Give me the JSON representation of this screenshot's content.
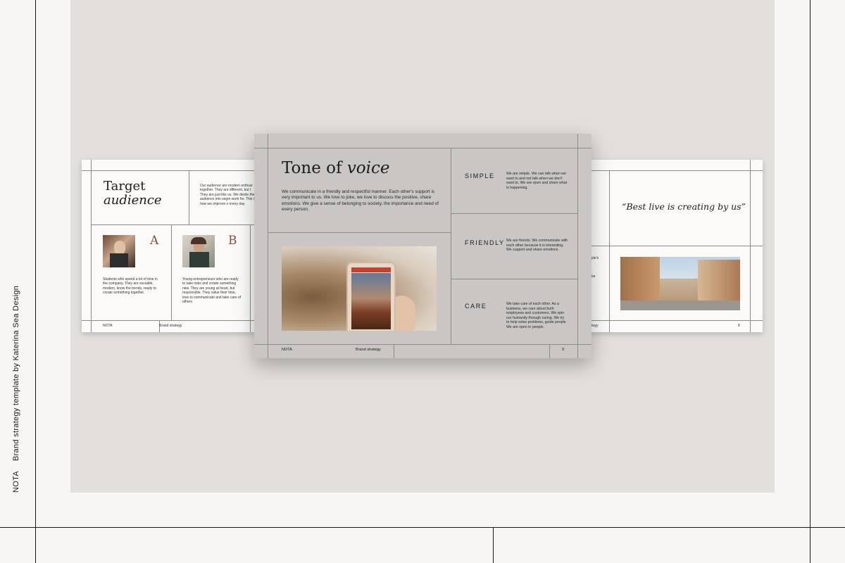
{
  "sidebar": {
    "brand": "NOTA",
    "caption": "Brand strategy template by Katerina Sea Design"
  },
  "left_slide": {
    "title_line1": "Target",
    "title_line2": "audience",
    "intro": "Our audience are modern enthusi together. They are different, but t They are just like us. We divide the audience into segm work for. This is how we improve o every day.",
    "segment_a": {
      "letter": "A",
      "text": "Students who spend a lot of time in the company. They are sociable, modern, know the trends, ready to create something together."
    },
    "segment_b": {
      "letter": "B",
      "text": "Young entrepreneurs who are ready to take risks and create something new. They are young at heart, but responsible. They value their time, love to communicate and take care of others."
    },
    "footer_brand": "NOTA",
    "footer_label": "Brand strategy"
  },
  "center_slide": {
    "title_plain": "Tone of",
    "title_italic": "voice",
    "body": "We communicate in a friendly and respectful manner. Each other's support is very important to us. We love to joke, we love to discuss the positive, share emotions. We give a sense of belonging to society, the importance and need of every person.",
    "traits": [
      {
        "name": "SIMPLE",
        "text": "We are simple. We can talk when we want to and not talk when we don't want to. We are open and share what is happening."
      },
      {
        "name": "FRIENDLY",
        "text": "We are friends. We communicate with each other because it is interesting. We support and share emotions."
      },
      {
        "name": "CARE",
        "text": "We take care of each other. As a business, we care about both employees and customers. We spin our humanity through caring. We try to help solve problems, guide people. We are open to people."
      }
    ],
    "footer_brand": "NOTA",
    "footer_label": "Brand strategy",
    "page_number": "9"
  },
  "right_slide": {
    "quote": "“Best live is creating by us”",
    "partial_text_1": "ple's",
    "partial_text_2": "lar",
    "footer_label": "tegy",
    "page_number": "8"
  },
  "colors": {
    "accent_letter": "#8b4a3f",
    "stage": "#e3dfdb",
    "center_slide": "#c9c6c4"
  }
}
